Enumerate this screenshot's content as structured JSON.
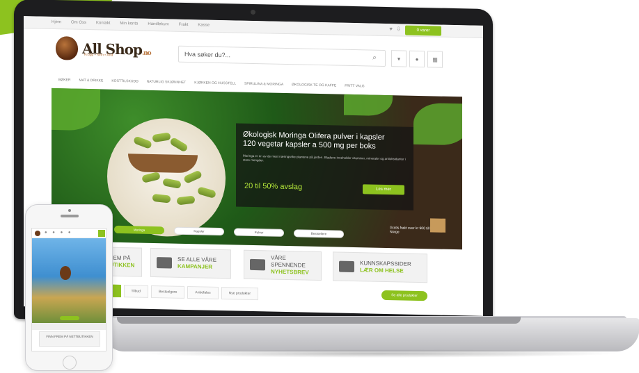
{
  "util": {
    "links": [
      "Hjem",
      "Om Oss",
      "Kontakt",
      "Min konto",
      "Handlekurv",
      "Frakt",
      "Kasse"
    ],
    "cart_label": "0 varer"
  },
  "logo": {
    "name": "All Shop",
    "tld": ".no",
    "tagline": "Kropp • Sinn • Ånd"
  },
  "search": {
    "placeholder": "Hva søker du?..."
  },
  "nav": [
    "Bøker",
    "Mat & drikke",
    "Kosttilskudd",
    "Naturlig skjønnhet",
    "Kjøkken og husstell",
    "Spirulina & Moringa",
    "Økologisk te og kaffe",
    "Fritt valg"
  ],
  "hero": {
    "headline_1": "Økologisk Moringa Olifera pulver i kapsler",
    "headline_2": "120 vegetar kapsler a 500 mg per boks",
    "body": "Moringa er en av de mest næringsrike plantene på jorden. Bladene inneholder vitaminer, mineraler og antioksidanter i store mengder.",
    "save": "20 til 50% avslag",
    "cta": "Les mer",
    "pills": [
      "Moringa",
      "Kapsler",
      "Pulver",
      "Bestsellere"
    ],
    "shipping": "Gratis frakt over kr 900 til hele Norge"
  },
  "features": [
    {
      "line1": "FINN FREM PÅ",
      "line2": "NETTBUTIKKEN"
    },
    {
      "line1": "SE ALLE VÅRE",
      "line2": "KAMPANJER"
    },
    {
      "line1": "VÅRE SPENNENDE",
      "line2": "NYHETSBREV"
    },
    {
      "line1": "KUNNSKAPSSIDER",
      "line2": "LÆR OM HELSE"
    }
  ],
  "tabs": [
    "Nyheter",
    "Tilbud",
    "Bestselgere",
    "Anbefales",
    "Nye produkter"
  ],
  "tabs_cta": "Se alle produkter",
  "phone": {
    "footer": "FINN FREM PÅ NETTBUTIKKEN"
  }
}
